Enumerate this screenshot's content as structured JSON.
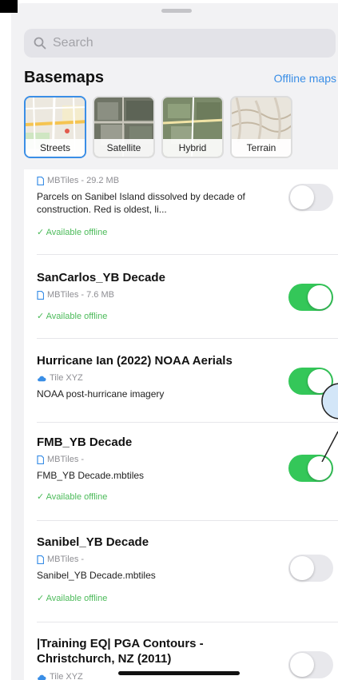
{
  "search": {
    "placeholder": "Search"
  },
  "basemaps": {
    "title": "Basemaps",
    "offline_link": "Offline maps",
    "items": [
      {
        "label": "Streets",
        "selected": true
      },
      {
        "label": "Satellite",
        "selected": false
      },
      {
        "label": "Hybrid",
        "selected": false
      },
      {
        "label": "Terrain",
        "selected": false
      }
    ]
  },
  "layers": [
    {
      "type": "MBTiles - 29.2 MB",
      "type_icon": "file-icon",
      "desc": "Parcels on Sanibel Island dissolved by decade of construction. Red is oldest, li...",
      "offline": "✓ Available offline",
      "enabled": false
    },
    {
      "title": "SanCarlos_YB Decade",
      "type": "MBTiles - 7.6 MB",
      "type_icon": "file-icon",
      "offline": "✓ Available offline",
      "enabled": true
    },
    {
      "title": "Hurricane Ian (2022) NOAA Aerials",
      "type": "Tile XYZ",
      "type_icon": "cloud-icon",
      "desc": "NOAA post-hurricane imagery",
      "enabled": true
    },
    {
      "title": "FMB_YB Decade",
      "type": "MBTiles -",
      "type_icon": "file-icon",
      "desc": "FMB_YB Decade.mbtiles",
      "offline": "✓ Available offline",
      "enabled": true
    },
    {
      "title": "Sanibel_YB Decade",
      "type": "MBTiles -",
      "type_icon": "file-icon",
      "desc": "Sanibel_YB Decade.mbtiles",
      "offline": "✓ Available offline",
      "enabled": false
    },
    {
      "title": "|Training EQ| PGA Contours - Christchurch, NZ (2011)",
      "type": "Tile XYZ",
      "type_icon": "cloud-icon",
      "enabled": false
    }
  ],
  "colors": {
    "accent": "#3a8ee6",
    "toggle_on": "#34c759",
    "offline_green": "#4cbb5a"
  }
}
